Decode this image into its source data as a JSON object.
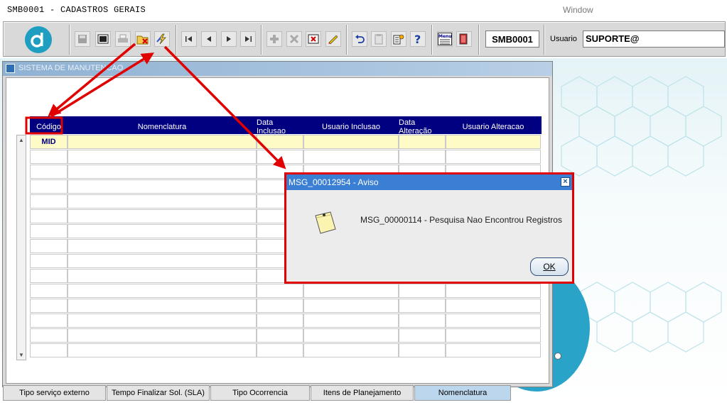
{
  "app": {
    "title": "SMB0001 - CADASTROS GERAIS",
    "window_menu": "Window"
  },
  "toolbar": {
    "form_code": "SMB0001",
    "user_label": "Usuario",
    "user_value": "SUPORTE@",
    "menu_icon_text": "Menu",
    "buttons": [
      "save-icon",
      "print-preview-icon",
      "print-icon",
      "clear-query-icon",
      "execute-query-icon",
      "first-record-icon",
      "previous-record-icon",
      "next-record-icon",
      "last-record-icon",
      "insert-record-icon",
      "delete-record-icon",
      "clear-record-icon",
      "edit-icon",
      "undo-icon",
      "clipboard-icon",
      "list-values-icon",
      "help-icon",
      "menu-icon",
      "exit-icon"
    ]
  },
  "form": {
    "title": "SISTEMA DE MANUTENCAO",
    "grid": {
      "columns": [
        "Código",
        "Nomenclatura",
        "Data Inclusao",
        "Usuario Inclusao",
        "Data Alteração",
        "Usuario Alteracao"
      ],
      "current_row": {
        "codigo": "MID"
      },
      "row_count": 15
    },
    "tabs": [
      {
        "label": "Tipo serviço externo",
        "active": false
      },
      {
        "label": "Tempo Finalizar Sol. (SLA)",
        "active": false
      },
      {
        "label": "Tipo Ocorrencia",
        "active": false
      },
      {
        "label": "Itens de Planejamento",
        "active": false
      },
      {
        "label": "Nomenclatura",
        "active": true
      }
    ]
  },
  "dialog": {
    "title": "MSG_00012954 - Aviso",
    "message": "MSG_00000114 - Pesquisa Nao Encontrou Registros",
    "ok_label": "OK"
  },
  "colors": {
    "grid_header": "#000080",
    "current_row": "#fffbc7",
    "annotation": "#e00000",
    "dialog_title": "#3a7fd3"
  }
}
